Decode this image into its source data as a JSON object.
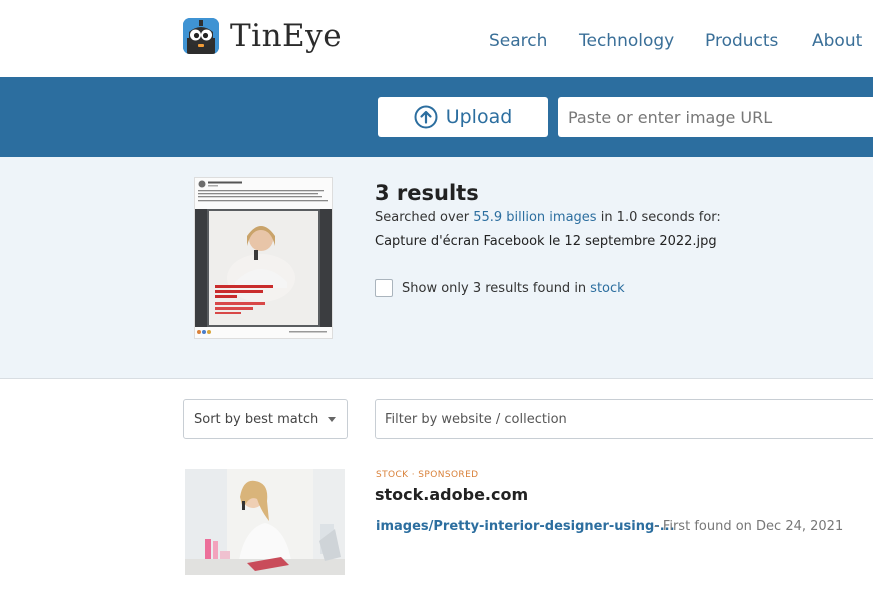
{
  "brand": {
    "name": "TinEye"
  },
  "nav": {
    "items": [
      "Search",
      "Technology",
      "Products",
      "About"
    ]
  },
  "upload": {
    "label": "Upload",
    "url_placeholder": "Paste or enter image URL"
  },
  "summary": {
    "results_count": "3 results",
    "searched_prefix": "Searched over",
    "searched_amount": "55.9 billion images",
    "searched_suffix": "in 1.0 seconds for:",
    "filename": "Capture d'écran Facebook le 12 septembre 2022.jpg",
    "stock_toggle_text": "Show only 3 results found in",
    "stock_toggle_link": "stock",
    "stock_toggle_checked": false
  },
  "filters": {
    "sort_value": "Sort by best match",
    "filter_placeholder": "Filter by website / collection"
  },
  "results": [
    {
      "tag_stock": "STOCK",
      "tag_separator": "·",
      "tag_sponsored": "SPONSORED",
      "domain": "stock.adobe.com",
      "link": "images/Pretty-interior-designer-using-...",
      "first_found": "- First found on Dec 24, 2021"
    }
  ],
  "colors": {
    "brand_blue": "#2c6e9f",
    "link_blue": "#3a6f98",
    "sponsored_orange": "#d9813a",
    "summary_bg": "#eef4f9"
  },
  "icons": {
    "upload": "arrow-up-circle-icon",
    "logo": "robot-logo-icon",
    "sort_caret": "caret-down-icon"
  }
}
